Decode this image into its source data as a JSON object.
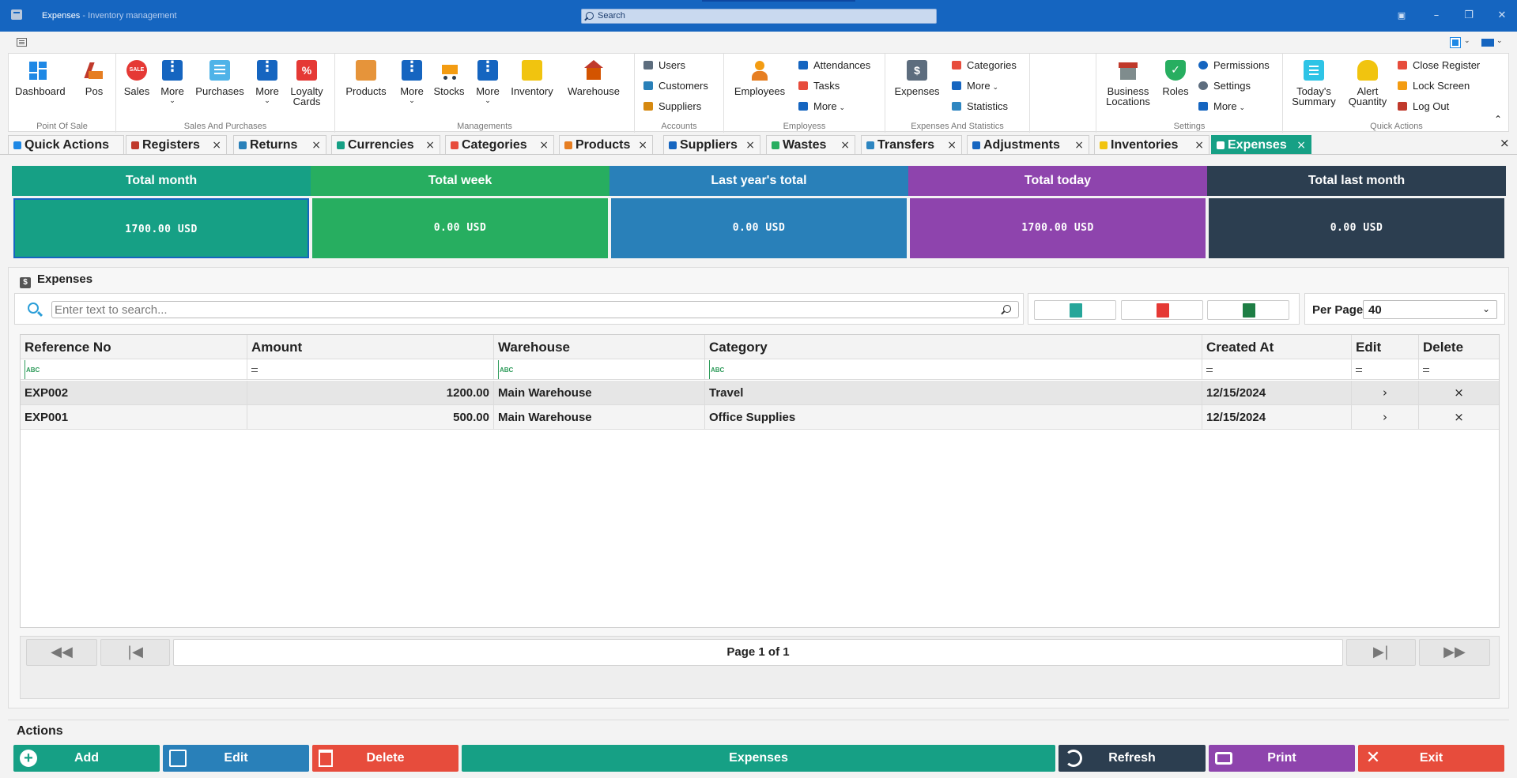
{
  "titlebar": {
    "app_name": "Expenses",
    "subtitle": " - Inventory management",
    "search_label": "Search",
    "minimize": "–",
    "restore": "❐",
    "close": "✕"
  },
  "ribbon": {
    "groups": {
      "pos": "Point Of Sale",
      "sales": "Sales And Purchases",
      "managements": "Managements",
      "accounts": "Accounts",
      "employees": "Employess",
      "expenses": "Expenses And Statistics",
      "settings": "Settings",
      "quick": "Quick Actions"
    },
    "dashboard": "Dashboard",
    "pos": "Pos",
    "sales": "Sales",
    "more": "More",
    "purchases": "Purchases",
    "loyalty": "Loyalty Cards",
    "products": "Products",
    "stocks": "Stocks",
    "inventory": "Inventory",
    "warehouse": "Warehouse",
    "users": "Users",
    "customers": "Customers",
    "suppliers": "Suppliers",
    "employees": "Employees",
    "attendances": "Attendances",
    "tasks": "Tasks",
    "more_dd": "More",
    "expenses": "Expenses",
    "categories": "Categories",
    "statistics": "Statistics",
    "business_locations": "Business Locations",
    "roles": "Roles",
    "permissions": "Permissions",
    "settings": "Settings",
    "todays_summary": "Today's Summary",
    "alert_quantity": "Alert Quantity",
    "close_register": "Close Register",
    "lock_screen": "Lock Screen",
    "log_out": "Log Out"
  },
  "tabs": [
    {
      "label": "Quick Actions",
      "color": "#1e88e5"
    },
    {
      "label": "Registers",
      "color": "#c0392b"
    },
    {
      "label": "Returns",
      "color": "#2980b9"
    },
    {
      "label": "Currencies",
      "color": "#16a085"
    },
    {
      "label": "Categories",
      "color": "#e74c3c"
    },
    {
      "label": "Products",
      "color": "#e67e22"
    },
    {
      "label": "Suppliers",
      "color": "#1565c0"
    },
    {
      "label": "Wastes",
      "color": "#27ae60"
    },
    {
      "label": "Transfers",
      "color": "#2e86c1"
    },
    {
      "label": "Adjustments",
      "color": "#1565c0"
    },
    {
      "label": "Inventories",
      "color": "#f1c40f"
    },
    {
      "label": "Expenses",
      "color": "#ffffff"
    }
  ],
  "cards": [
    {
      "title": "Total month",
      "value": "1700.00 USD",
      "head": "#16a085",
      "body": "#16a085"
    },
    {
      "title": "Total week",
      "value": "0.00 USD",
      "head": "#27ae60",
      "body": "#27ae60"
    },
    {
      "title": "Last year's total",
      "value": "0.00 USD",
      "head": "#2980b9",
      "body": "#2980b9"
    },
    {
      "title": "Total today",
      "value": "1700.00 USD",
      "head": "#8e44ad",
      "body": "#8e44ad"
    },
    {
      "title": "Total last month",
      "value": "0.00 USD",
      "head": "#2c3e50",
      "body": "#2c3e50"
    }
  ],
  "panel": {
    "title": "Expenses",
    "search_placeholder": "Enter text to search...",
    "per_page_label": "Per Page",
    "per_page_value": "40"
  },
  "table": {
    "headers": [
      "Reference No",
      "Amount",
      "Warehouse",
      "Category",
      "Created At",
      "Edit",
      "Delete"
    ],
    "rows": [
      {
        "ref": "EXP002",
        "amount": "1200.00",
        "warehouse": "Main Warehouse",
        "category": "Travel",
        "created": "12/15/2024",
        "edit": "›",
        "delete": "×"
      },
      {
        "ref": "EXP001",
        "amount": "500.00",
        "warehouse": "Main Warehouse",
        "category": "Office Supplies",
        "created": "12/15/2024",
        "edit": "›",
        "delete": "×"
      }
    ]
  },
  "pager": {
    "info": "Page 1 of 1",
    "first": "◀◀",
    "prev": "|◀",
    "next": "▶|",
    "last": "▶▶"
  },
  "actions": {
    "label": "Actions",
    "add": "Add",
    "edit": "Edit",
    "delete": "Delete",
    "expenses": "Expenses",
    "refresh": "Refresh",
    "print": "Print",
    "exit": "Exit"
  }
}
